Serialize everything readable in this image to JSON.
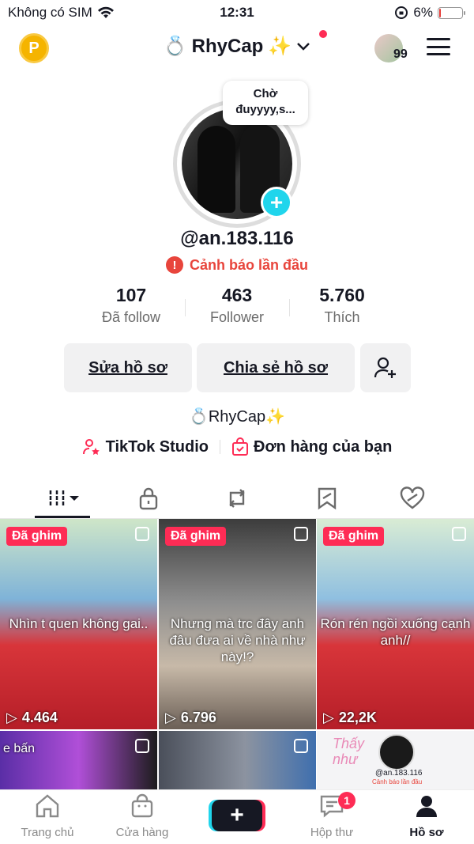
{
  "status_bar": {
    "carrier": "Không có SIM",
    "time": "12:31",
    "battery": "6%",
    "battery_level": 0.06
  },
  "header": {
    "coin_label": "P",
    "username": "RhyCap",
    "friends_count": "99"
  },
  "profile": {
    "note": "Chờ đuyyyy,s...",
    "handle": "@an.183.116",
    "warning": "Cảnh báo lần đầu",
    "stats": [
      {
        "value": "107",
        "label": "Đã follow"
      },
      {
        "value": "463",
        "label": "Follower"
      },
      {
        "value": "5.760",
        "label": "Thích"
      }
    ],
    "edit_button": "Sửa hồ sơ",
    "share_button": "Chia sẻ hồ sơ",
    "bio": "RhyCap",
    "link_studio": "TikTok Studio",
    "link_orders": "Đơn hàng của bạn"
  },
  "tabs": [
    "videos",
    "private",
    "reposts",
    "favorites",
    "liked"
  ],
  "videos": [
    {
      "pinned": "Đã ghim",
      "caption": "Nhìn t quen không gai..",
      "views": "4.464"
    },
    {
      "pinned": "Đã ghim",
      "caption": "Nhưng mà trc đây anh đâu đưa ai về nhà như này!?",
      "views": "6.796"
    },
    {
      "pinned": "Đã ghim",
      "caption": "Rón rén ngồi xuống cạnh anh//",
      "views": "22,2K"
    }
  ],
  "video_row2": [
    {
      "caption": "e bấn"
    },
    {
      "caption": ""
    },
    {
      "caption": "Thấy như",
      "handle": "@an.183.116",
      "warning": "Cảnh báo lần đầu"
    }
  ],
  "bottom_nav": [
    {
      "label": "Trang chủ"
    },
    {
      "label": "Cửa hàng"
    },
    {
      "label": ""
    },
    {
      "label": "Hộp thư",
      "badge": "1"
    },
    {
      "label": "Hồ sơ"
    }
  ]
}
